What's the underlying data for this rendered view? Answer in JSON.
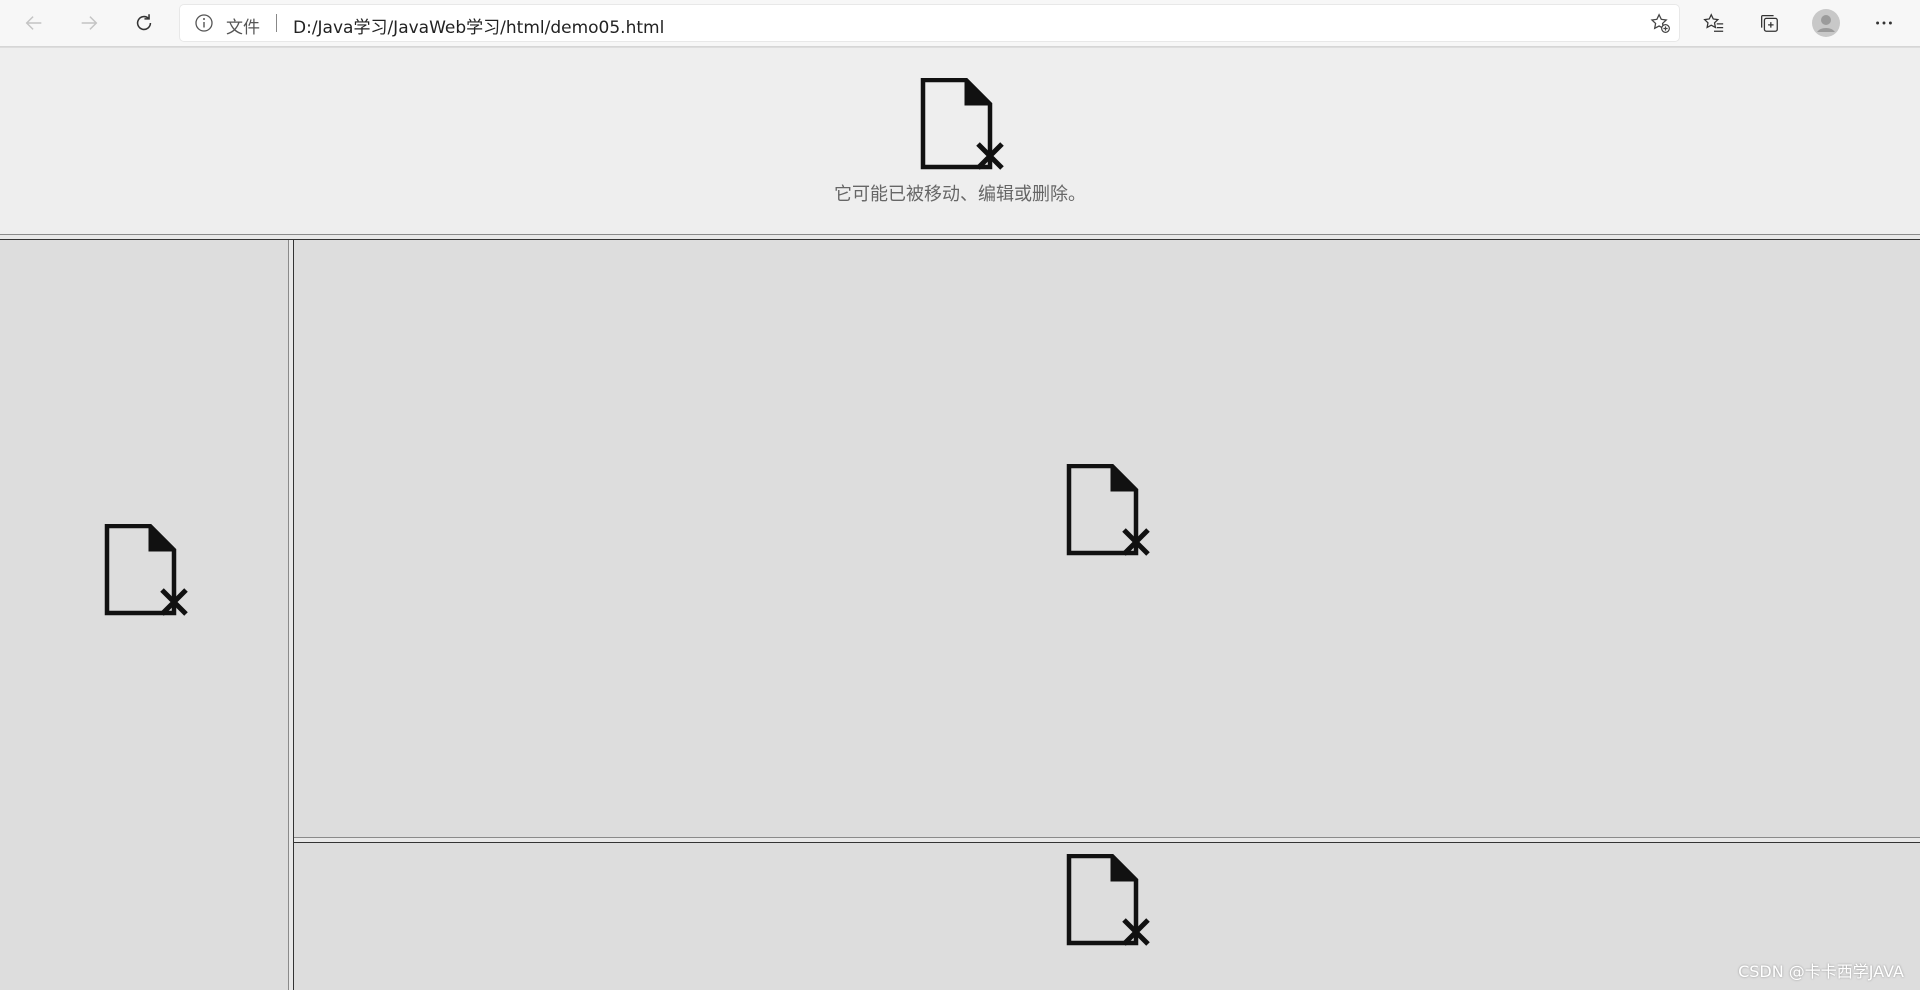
{
  "browser": {
    "address_label": "文件",
    "url": "D:/Java学习/JavaWeb学习/html/demo05.html"
  },
  "frames": {
    "top": {
      "error_message": "它可能已被移动、编辑或删除。"
    }
  },
  "watermark": "CSDN @卡卡西学JAVA",
  "icons": {
    "back": "arrow-left-icon",
    "forward": "arrow-right-icon",
    "refresh": "refresh-icon",
    "info": "info-icon",
    "add_favorite": "star-add-icon",
    "favorites": "favorites-list-icon",
    "collections": "collections-icon",
    "profile": "profile-avatar-icon",
    "menu": "more-icon",
    "missing_file": "file-missing-icon"
  }
}
